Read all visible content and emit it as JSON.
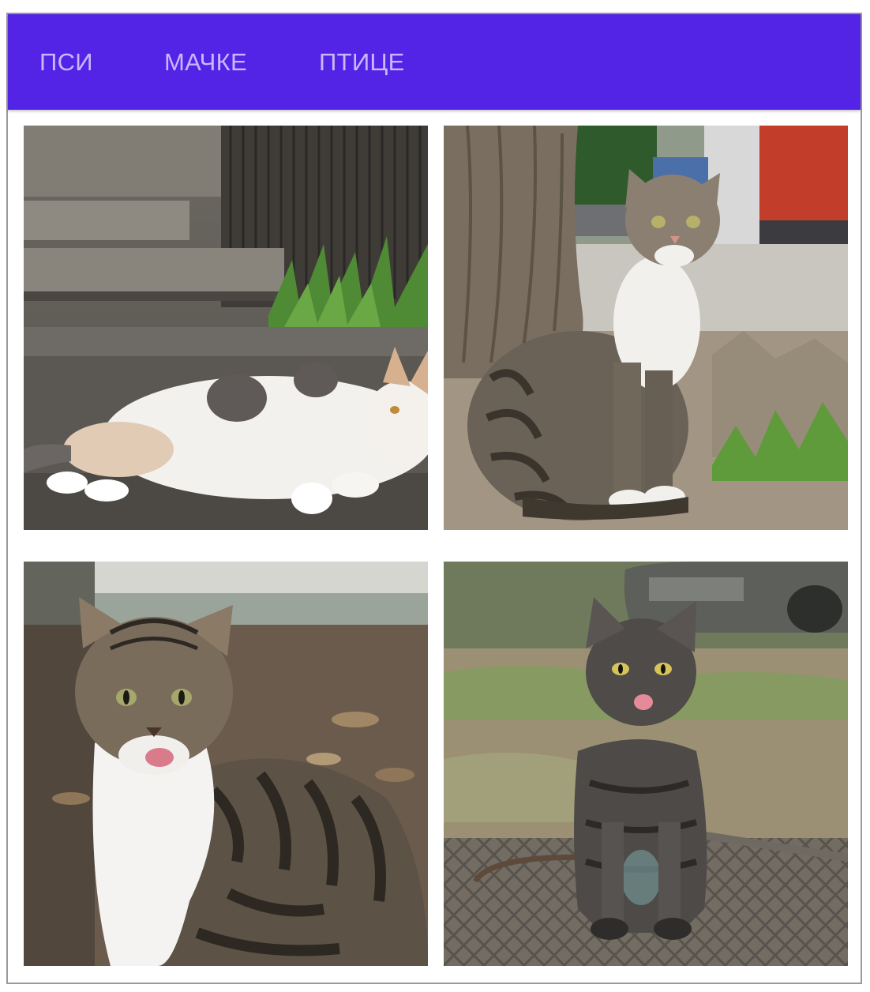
{
  "tabs": [
    {
      "label": "ПСИ"
    },
    {
      "label": "МАЧКЕ"
    },
    {
      "label": "ПТИЦЕ"
    }
  ],
  "colors": {
    "appbar": "#5323e6",
    "tab_text": "#c9b8ff"
  },
  "gallery": {
    "images": [
      {
        "subject": "calico-cat-lying-on-steps"
      },
      {
        "subject": "tabby-cat-sitting-by-tree"
      },
      {
        "subject": "tabby-cat-licking-lips"
      },
      {
        "subject": "grey-cat-sitting-on-grate"
      }
    ]
  }
}
